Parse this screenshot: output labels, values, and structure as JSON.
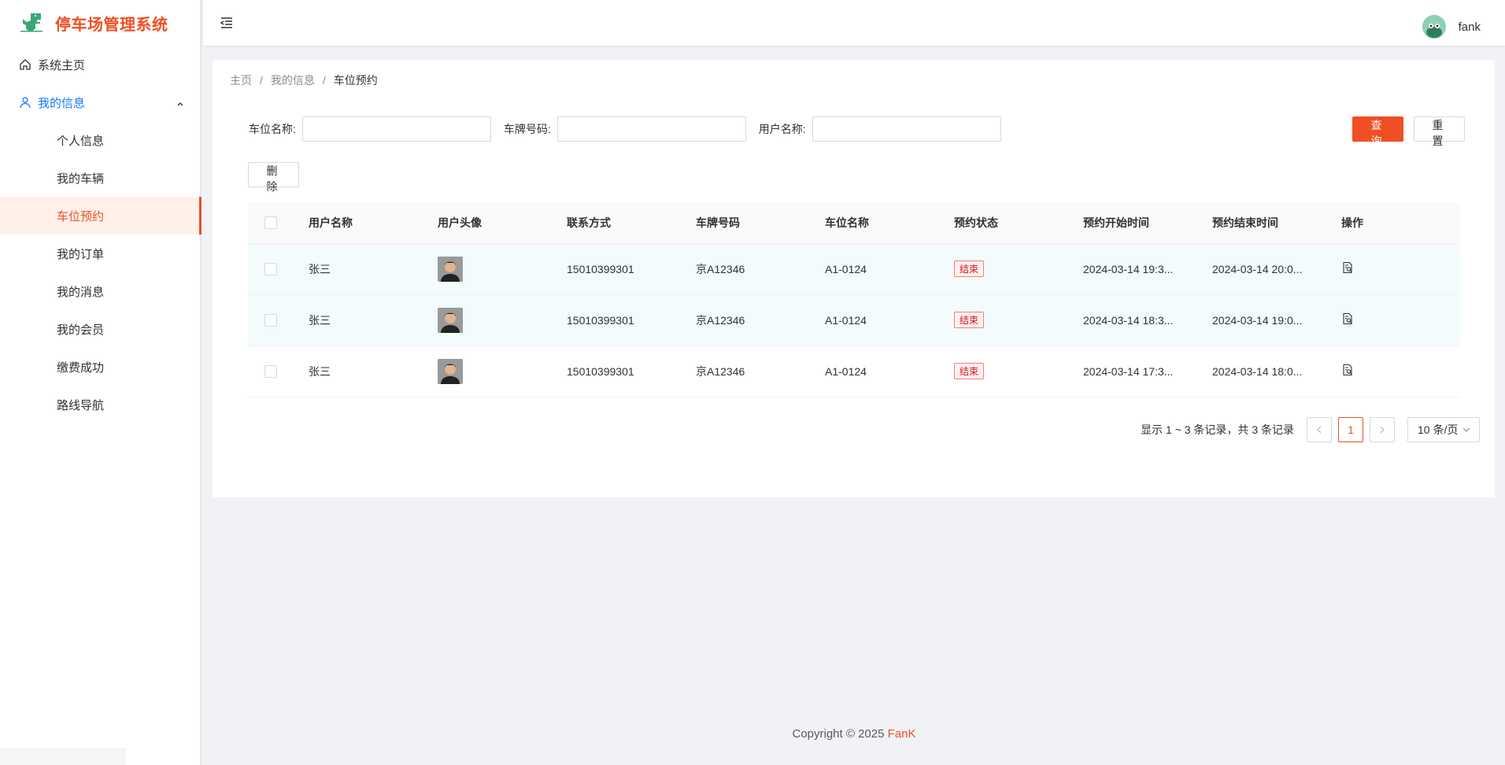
{
  "app": {
    "title": "停车场管理系统"
  },
  "sidebar": {
    "home": "系统主页",
    "group": "我的信息",
    "items": [
      "个人信息",
      "我的车辆",
      "车位预约",
      "我的订单",
      "我的消息",
      "我的会员",
      "缴费成功",
      "路线导航"
    ],
    "active_index": 2
  },
  "header": {
    "username": "fank"
  },
  "breadcrumb": [
    "主页",
    "我的信息",
    "车位预约"
  ],
  "filters": {
    "space_label": "车位名称:",
    "plate_label": "车牌号码:",
    "user_label": "用户名称:",
    "space_value": "",
    "plate_value": "",
    "user_value": ""
  },
  "buttons": {
    "query": "查询",
    "reset": "重置",
    "delete": "删除"
  },
  "table": {
    "columns": [
      "用户名称",
      "用户头像",
      "联系方式",
      "车牌号码",
      "车位名称",
      "预约状态",
      "预约开始时间",
      "预约结束时间",
      "操作"
    ],
    "rows": [
      {
        "user": "张三",
        "phone": "15010399301",
        "plate": "京A12346",
        "space": "A1-0124",
        "status": "结束",
        "start": "2024-03-14 19:3...",
        "end": "2024-03-14 20:0..."
      },
      {
        "user": "张三",
        "phone": "15010399301",
        "plate": "京A12346",
        "space": "A1-0124",
        "status": "结束",
        "start": "2024-03-14 18:3...",
        "end": "2024-03-14 19:0..."
      },
      {
        "user": "张三",
        "phone": "15010399301",
        "plate": "京A12346",
        "space": "A1-0124",
        "status": "结束",
        "start": "2024-03-14 17:3...",
        "end": "2024-03-14 18:0..."
      }
    ]
  },
  "pagination": {
    "info": "显示 1 ~ 3 条记录，共 3 条记录",
    "current_page": "1",
    "page_size": "10 条/页"
  },
  "footer": {
    "copyright": "Copyright © 2025 ",
    "brand": "FanK"
  },
  "colors": {
    "accent": "#f04e23",
    "link": "#1677ff",
    "status_tag": "#cf1322"
  }
}
